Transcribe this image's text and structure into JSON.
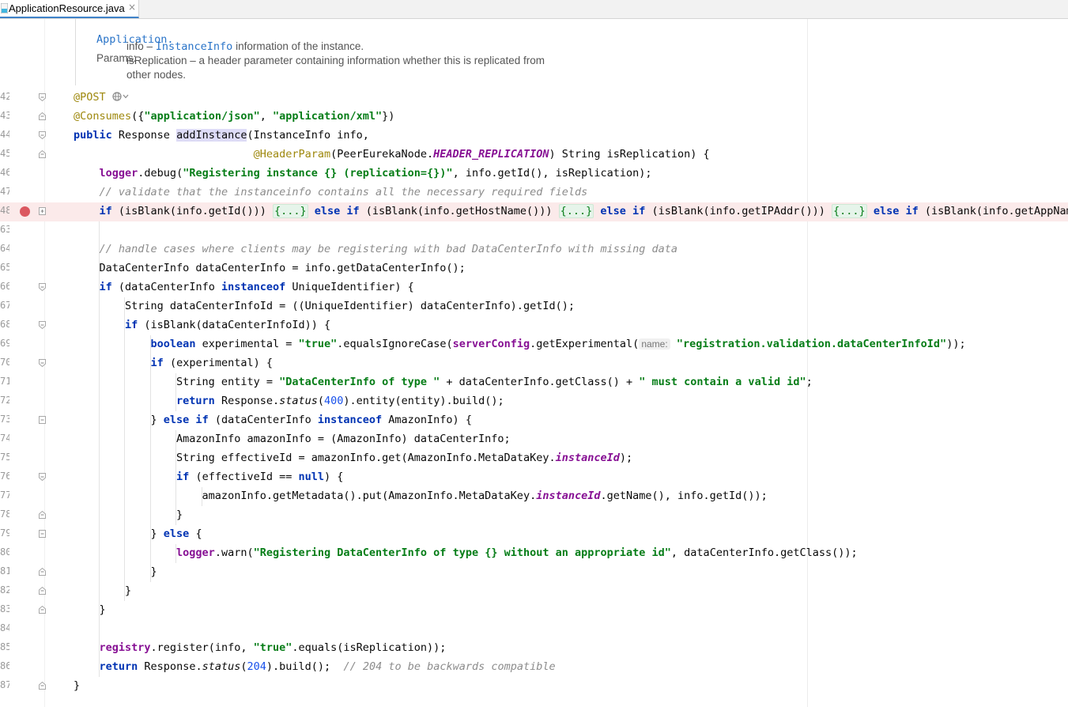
{
  "tab": {
    "title": "ApplicationResource.java",
    "icon": "java-class-icon",
    "close": "×"
  },
  "doc": {
    "line0": "Application.",
    "params_label": "Params:",
    "param1_name": "info – ",
    "param1_type": "InstanceInfo",
    "param1_desc": " information of the instance.",
    "param2": "isReplication – a header parameter containing information whether this is replicated from",
    "param2_cont": "other nodes."
  },
  "lines": [
    {
      "n": "42",
      "s": [
        {
          "t": "@POST",
          "c": "ann"
        }
      ],
      "extra": "globe"
    },
    {
      "n": "43",
      "s": [
        {
          "t": "@Consumes",
          "c": "ann"
        },
        {
          "t": "({",
          "c": ""
        },
        {
          "t": "\"application/json\"",
          "c": "str"
        },
        {
          "t": ", ",
          "c": ""
        },
        {
          "t": "\"application/xml\"",
          "c": "str"
        },
        {
          "t": "})",
          "c": ""
        }
      ]
    },
    {
      "n": "44",
      "s": [
        {
          "t": "public",
          "c": "kw"
        },
        {
          "t": " Response ",
          "c": ""
        },
        {
          "t": "addInstance",
          "c": "fn-hl"
        },
        {
          "t": "(InstanceInfo info,",
          "c": ""
        }
      ]
    },
    {
      "n": "45",
      "s": [
        {
          "t": "                            ",
          "c": ""
        },
        {
          "t": "@HeaderParam",
          "c": "ann"
        },
        {
          "t": "(PeerEurekaNode.",
          "c": ""
        },
        {
          "t": "HEADER_REPLICATION",
          "c": "fldi"
        },
        {
          "t": ") String isReplication) {",
          "c": ""
        }
      ]
    },
    {
      "n": "46",
      "s": [
        {
          "t": "    ",
          "c": ""
        },
        {
          "t": "logger",
          "c": "fld"
        },
        {
          "t": ".debug(",
          "c": ""
        },
        {
          "t": "\"Registering instance {} (replication={})\"",
          "c": "str"
        },
        {
          "t": ", info.getId(), isReplication);",
          "c": ""
        }
      ]
    },
    {
      "n": "47",
      "s": [
        {
          "t": "    ",
          "c": ""
        },
        {
          "t": "// validate that the instanceinfo contains all the necessary required fields",
          "c": "cm"
        }
      ]
    },
    {
      "n": "48",
      "bp": true,
      "s": [
        {
          "t": "    ",
          "c": ""
        },
        {
          "t": "if",
          "c": "kw"
        },
        {
          "t": " (isBlank(info.getId())) ",
          "c": ""
        },
        {
          "t": "{...}",
          "c": "folded"
        },
        {
          "t": " ",
          "c": ""
        },
        {
          "t": "else if",
          "c": "kw"
        },
        {
          "t": " (isBlank(info.getHostName())) ",
          "c": ""
        },
        {
          "t": "{...}",
          "c": "folded"
        },
        {
          "t": " ",
          "c": ""
        },
        {
          "t": "else if",
          "c": "kw"
        },
        {
          "t": " (isBlank(info.getIPAddr())) ",
          "c": ""
        },
        {
          "t": "{...}",
          "c": "folded"
        },
        {
          "t": " ",
          "c": ""
        },
        {
          "t": "else if",
          "c": "kw"
        },
        {
          "t": " (isBlank(info.getAppName())",
          "c": ""
        }
      ]
    },
    {
      "n": "63",
      "s": []
    },
    {
      "n": "64",
      "s": [
        {
          "t": "    ",
          "c": ""
        },
        {
          "t": "// handle cases where clients may be registering with bad DataCenterInfo with missing data",
          "c": "cm"
        }
      ]
    },
    {
      "n": "65",
      "s": [
        {
          "t": "    DataCenterInfo dataCenterInfo = info.getDataCenterInfo();",
          "c": ""
        }
      ]
    },
    {
      "n": "66",
      "s": [
        {
          "t": "    ",
          "c": ""
        },
        {
          "t": "if",
          "c": "kw"
        },
        {
          "t": " (dataCenterInfo ",
          "c": ""
        },
        {
          "t": "instanceof",
          "c": "kw"
        },
        {
          "t": " UniqueIdentifier) {",
          "c": ""
        }
      ]
    },
    {
      "n": "67",
      "s": [
        {
          "t": "        String dataCenterInfoId = ((UniqueIdentifier) dataCenterInfo).getId();",
          "c": ""
        }
      ]
    },
    {
      "n": "68",
      "s": [
        {
          "t": "        ",
          "c": ""
        },
        {
          "t": "if",
          "c": "kw"
        },
        {
          "t": " (isBlank(dataCenterInfoId)) {",
          "c": ""
        }
      ]
    },
    {
      "n": "69",
      "s": [
        {
          "t": "            ",
          "c": ""
        },
        {
          "t": "boolean",
          "c": "kw"
        },
        {
          "t": " experimental = ",
          "c": ""
        },
        {
          "t": "\"true\"",
          "c": "str"
        },
        {
          "t": ".equalsIgnoreCase(",
          "c": ""
        },
        {
          "t": "serverConfig",
          "c": "fld"
        },
        {
          "t": ".getExperimental(",
          "c": ""
        },
        {
          "t": "name:",
          "c": "hint"
        },
        {
          "t": " ",
          "c": ""
        },
        {
          "t": "\"registration.validation.dataCenterInfoId\"",
          "c": "str"
        },
        {
          "t": "));",
          "c": ""
        }
      ]
    },
    {
      "n": "70",
      "s": [
        {
          "t": "            ",
          "c": ""
        },
        {
          "t": "if",
          "c": "kw"
        },
        {
          "t": " (experimental) {",
          "c": ""
        }
      ]
    },
    {
      "n": "71",
      "s": [
        {
          "t": "                String entity = ",
          "c": ""
        },
        {
          "t": "\"DataCenterInfo of type \"",
          "c": "str"
        },
        {
          "t": " + dataCenterInfo.getClass() + ",
          "c": ""
        },
        {
          "t": "\" must contain a valid id\"",
          "c": "str"
        },
        {
          "t": ";",
          "c": ""
        }
      ]
    },
    {
      "n": "72",
      "s": [
        {
          "t": "                ",
          "c": ""
        },
        {
          "t": "return",
          "c": "kw"
        },
        {
          "t": " Response.",
          "c": ""
        },
        {
          "t": "status",
          "c": "ital"
        },
        {
          "t": "(",
          "c": ""
        },
        {
          "t": "400",
          "c": "num"
        },
        {
          "t": ").entity(entity).build();",
          "c": ""
        }
      ]
    },
    {
      "n": "73",
      "s": [
        {
          "t": "            } ",
          "c": ""
        },
        {
          "t": "else if",
          "c": "kw"
        },
        {
          "t": " (dataCenterInfo ",
          "c": ""
        },
        {
          "t": "instanceof",
          "c": "kw"
        },
        {
          "t": " AmazonInfo) {",
          "c": ""
        }
      ]
    },
    {
      "n": "74",
      "s": [
        {
          "t": "                AmazonInfo amazonInfo = (AmazonInfo) dataCenterInfo;",
          "c": ""
        }
      ]
    },
    {
      "n": "75",
      "s": [
        {
          "t": "                String effectiveId = amazonInfo.get(AmazonInfo.MetaDataKey.",
          "c": ""
        },
        {
          "t": "instanceId",
          "c": "fldi"
        },
        {
          "t": ");",
          "c": ""
        }
      ]
    },
    {
      "n": "76",
      "s": [
        {
          "t": "                ",
          "c": ""
        },
        {
          "t": "if",
          "c": "kw"
        },
        {
          "t": " (effectiveId == ",
          "c": ""
        },
        {
          "t": "null",
          "c": "kw"
        },
        {
          "t": ") {",
          "c": ""
        }
      ]
    },
    {
      "n": "77",
      "s": [
        {
          "t": "                    amazonInfo.getMetadata().put(AmazonInfo.MetaDataKey.",
          "c": ""
        },
        {
          "t": "instanceId",
          "c": "fldi"
        },
        {
          "t": ".getName(), info.getId());",
          "c": ""
        }
      ]
    },
    {
      "n": "78",
      "s": [
        {
          "t": "                }",
          "c": ""
        }
      ]
    },
    {
      "n": "79",
      "s": [
        {
          "t": "            } ",
          "c": ""
        },
        {
          "t": "else",
          "c": "kw"
        },
        {
          "t": " {",
          "c": ""
        }
      ]
    },
    {
      "n": "80",
      "s": [
        {
          "t": "                ",
          "c": ""
        },
        {
          "t": "logger",
          "c": "fld"
        },
        {
          "t": ".warn(",
          "c": ""
        },
        {
          "t": "\"Registering DataCenterInfo of type {} without an appropriate id\"",
          "c": "str"
        },
        {
          "t": ", dataCenterInfo.getClass());",
          "c": ""
        }
      ]
    },
    {
      "n": "81",
      "s": [
        {
          "t": "            }",
          "c": ""
        }
      ]
    },
    {
      "n": "82",
      "s": [
        {
          "t": "        }",
          "c": ""
        }
      ]
    },
    {
      "n": "83",
      "s": [
        {
          "t": "    }",
          "c": ""
        }
      ]
    },
    {
      "n": "84",
      "s": []
    },
    {
      "n": "85",
      "s": [
        {
          "t": "    ",
          "c": ""
        },
        {
          "t": "registry",
          "c": "fld"
        },
        {
          "t": ".register(info, ",
          "c": ""
        },
        {
          "t": "\"true\"",
          "c": "str"
        },
        {
          "t": ".equals(isReplication));",
          "c": ""
        }
      ]
    },
    {
      "n": "86",
      "s": [
        {
          "t": "    ",
          "c": ""
        },
        {
          "t": "return",
          "c": "kw"
        },
        {
          "t": " Response.",
          "c": ""
        },
        {
          "t": "status",
          "c": "ital"
        },
        {
          "t": "(",
          "c": ""
        },
        {
          "t": "204",
          "c": "num"
        },
        {
          "t": ").build();  ",
          "c": ""
        },
        {
          "t": "// 204 to be backwards compatible",
          "c": "cm"
        }
      ]
    },
    {
      "n": "87",
      "s": [
        {
          "t": "}",
          "c": ""
        }
      ]
    }
  ]
}
